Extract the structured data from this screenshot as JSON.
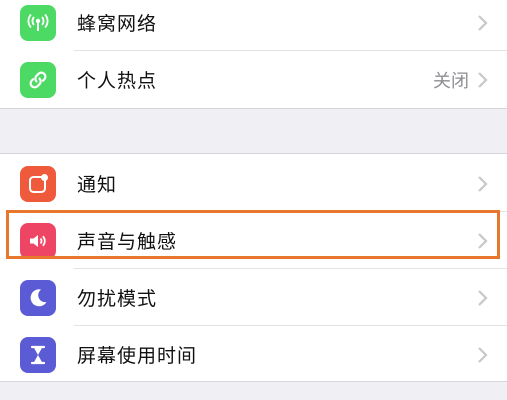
{
  "colors": {
    "background": "#efeff4",
    "cellular_icon": "#4cd964",
    "hotspot_icon": "#4cd964",
    "notifications_icon": "#f05a3c",
    "sounds_icon": "#ef4565",
    "dnd_icon": "#5b5bd6",
    "screentime_icon": "#5b5bd6",
    "highlight": "#e8772e"
  },
  "settings": {
    "group1": [
      {
        "label": "蜂窝网络",
        "icon": "antenna-icon"
      },
      {
        "label": "个人热点",
        "icon": "hotspot-link-icon",
        "value": "关闭"
      }
    ],
    "group2": [
      {
        "label": "通知",
        "icon": "notifications-icon"
      },
      {
        "label": "声音与触感",
        "icon": "speaker-icon",
        "highlighted": true
      },
      {
        "label": "勿扰模式",
        "icon": "moon-icon"
      },
      {
        "label": "屏幕使用时间",
        "icon": "hourglass-icon"
      }
    ]
  }
}
